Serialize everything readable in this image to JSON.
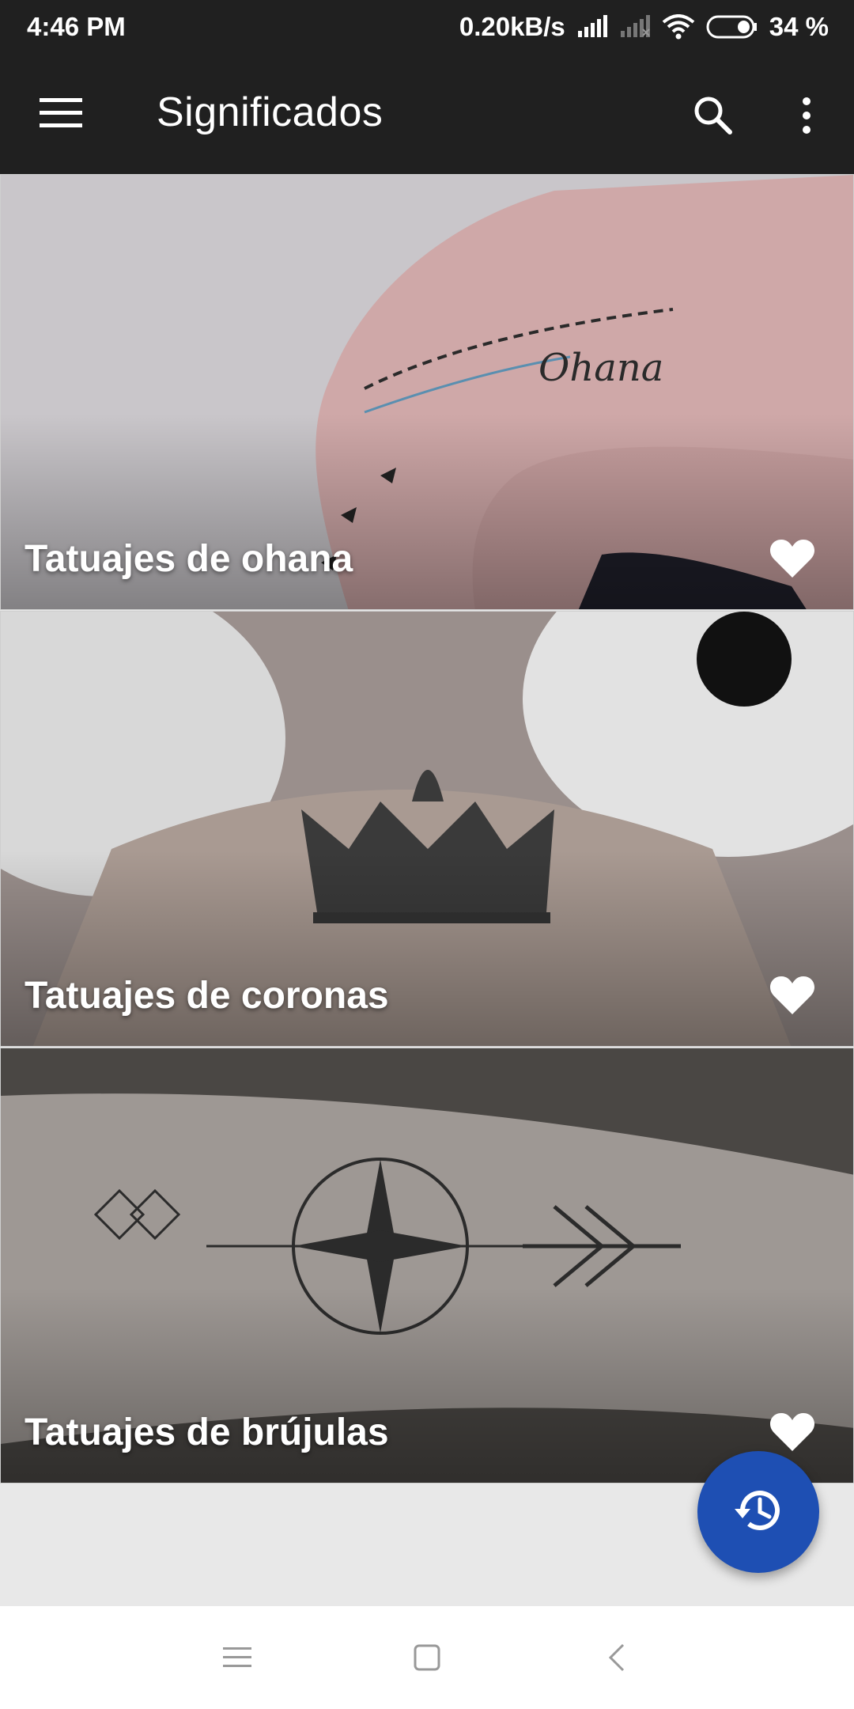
{
  "status_bar": {
    "time": "4:46 PM",
    "net_speed": "0.20kB/s",
    "battery": "34 %",
    "icons": [
      "signal-icon",
      "signal-weak-icon",
      "wifi-icon",
      "battery-icon"
    ]
  },
  "app_bar": {
    "title": "Significados",
    "icons": [
      "menu-icon",
      "search-icon",
      "more-vert-icon"
    ]
  },
  "cards": [
    {
      "title": "Tatuajes de ohana",
      "favorite_icon": "heart-icon"
    },
    {
      "title": "Tatuajes de coronas",
      "favorite_icon": "heart-icon"
    },
    {
      "title": "Tatuajes de brújulas",
      "favorite_icon": "heart-icon"
    }
  ],
  "fab": {
    "icon": "history-icon",
    "color": "#1e4fb3"
  },
  "nav_bar": {
    "icons": [
      "recents-icon",
      "home-icon",
      "back-icon"
    ]
  },
  "colors": {
    "app_bar": "#202020",
    "background": "#e8e8e8",
    "accent": "#1e4fb3"
  }
}
